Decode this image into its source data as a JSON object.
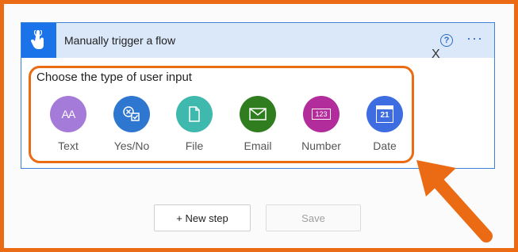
{
  "card": {
    "title": "Manually trigger a flow",
    "help_icon": "question-circle-icon",
    "more_icon": "ellipsis-icon",
    "close_label": "X",
    "trigger_icon": "touch-hand-icon"
  },
  "prompt": "Choose the type of user input",
  "options": [
    {
      "label": "Text",
      "icon": "text-icon",
      "color": "#a47bd8"
    },
    {
      "label": "Yes/No",
      "icon": "yes-no-icon",
      "color": "#2e77d0"
    },
    {
      "label": "File",
      "icon": "file-icon",
      "color": "#3fb8ad"
    },
    {
      "label": "Email",
      "icon": "email-icon",
      "color": "#2f7d1f"
    },
    {
      "label": "Number",
      "icon": "number-icon",
      "color": "#b32c9b"
    },
    {
      "label": "Date",
      "icon": "calendar-icon",
      "color": "#3d6de0"
    }
  ],
  "number_glyph": "123",
  "date_glyph": "21",
  "text_glyph": "AA",
  "buttons": {
    "new_step": "+ New step",
    "save": "Save"
  },
  "colors": {
    "accent": "#ea6b14",
    "header_bg": "#dbe8f9",
    "brand_blue": "#1a73e8"
  }
}
